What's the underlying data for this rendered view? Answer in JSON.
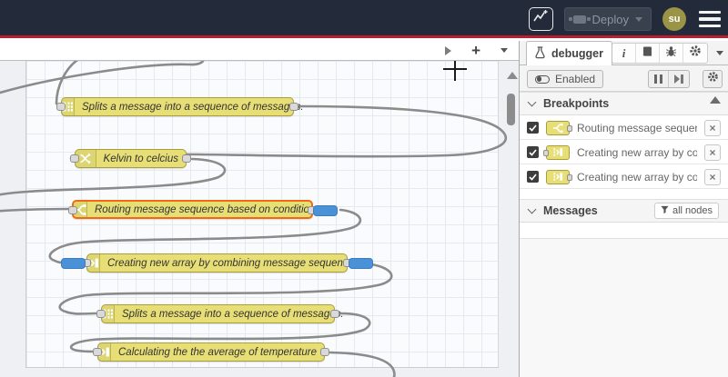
{
  "header": {
    "deploy_label": "Deploy",
    "avatar_text": "su"
  },
  "canvas": {
    "nodes": [
      {
        "icon": "split",
        "label": "Splits a message into a sequence of messages."
      },
      {
        "icon": "change",
        "label": "Kelvin to celcius"
      },
      {
        "icon": "switch",
        "label": "Routing message sequence based on condition",
        "selected": true,
        "breakpoint": "output"
      },
      {
        "icon": "join",
        "label": "Creating new array by combining message sequence",
        "breakpoint": "input+output"
      },
      {
        "icon": "split",
        "label": "Splits a message into a sequence of messages."
      },
      {
        "icon": "join",
        "label": "Calculating the the average of temperature"
      }
    ]
  },
  "sidebar": {
    "tab_label": "debugger",
    "toolbar": {
      "enabled_label": "Enabled"
    },
    "breakpoints": {
      "title": "Breakpoints",
      "items": [
        {
          "icon": "switch",
          "port": "output",
          "label": "Routing message sequence ba"
        },
        {
          "icon": "join",
          "port": "input",
          "label": "Creating new array by combini"
        },
        {
          "icon": "join",
          "port": "output",
          "label": "Creating new array by combini"
        }
      ]
    },
    "messages": {
      "title": "Messages",
      "filter_label": "all nodes"
    }
  },
  "colors": {
    "header_navy": "#232b3a",
    "red_line": "#bb1f2f",
    "node_yellow": "#e7de76",
    "selected_orange": "#f06a12",
    "breakpoint_blue": "#4b91d7",
    "wire_gray": "#8b8b8b"
  }
}
